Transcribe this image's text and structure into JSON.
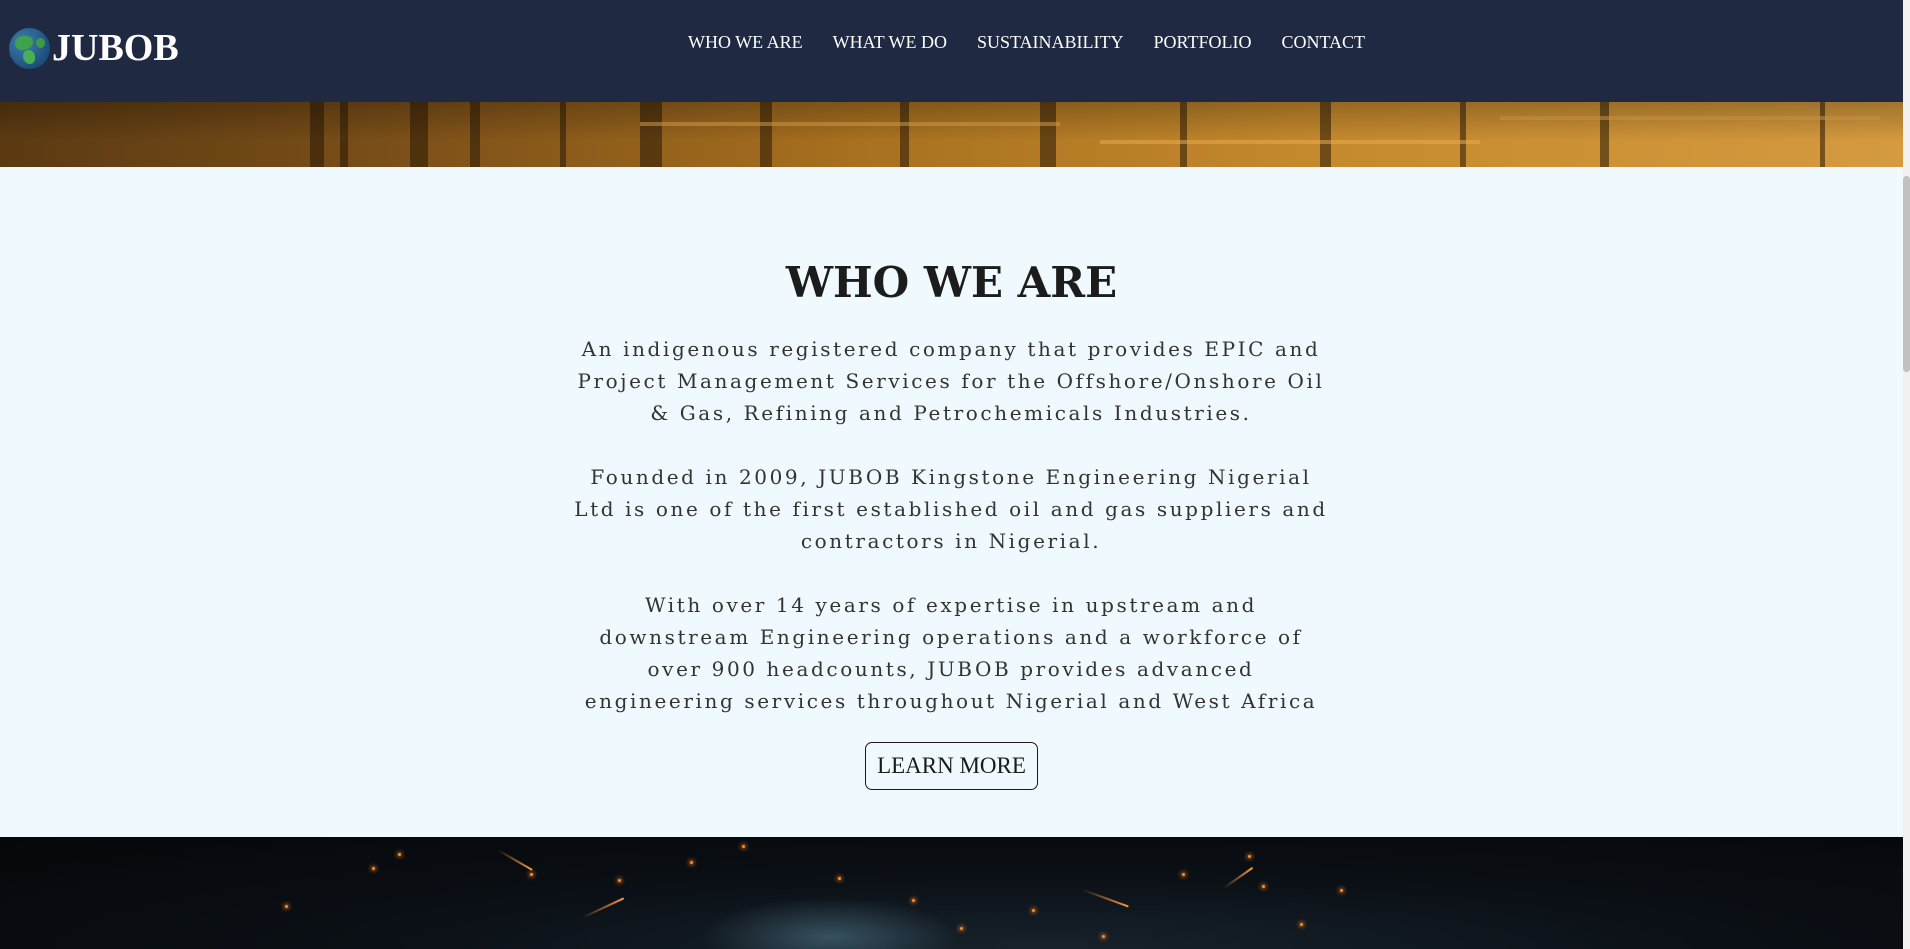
{
  "header": {
    "logo_text": "JUBOB",
    "nav": [
      {
        "label": "WHO WE ARE"
      },
      {
        "label": "WHAT WE DO"
      },
      {
        "label": "SUSTAINABILITY"
      },
      {
        "label": "PORTFOLIO"
      },
      {
        "label": "CONTACT"
      }
    ]
  },
  "about": {
    "title": "WHO WE ARE",
    "paragraphs": [
      "An indigenous registered company that provides EPIC and Project Management Services for the Offshore/Onshore Oil & Gas, Refining and Petrochemicals Industries.",
      "Founded in 2009, JUBOB Kingstone Engineering Nigerial Ltd is one of the first established oil and gas suppliers and contractors in Nigerial.",
      "With over 14 years of expertise in upstream and downstream Engineering operations and a workforce of over 900 headcounts, JUBOB provides advanced engineering services throughout Nigerial and West Africa"
    ],
    "button_label": "LEARN MORE"
  },
  "colors": {
    "header_bg": "#1f2942",
    "section_bg": "#f0f9fd",
    "text": "#1c1c1c"
  },
  "icons": {
    "logo": "globe-icon"
  }
}
